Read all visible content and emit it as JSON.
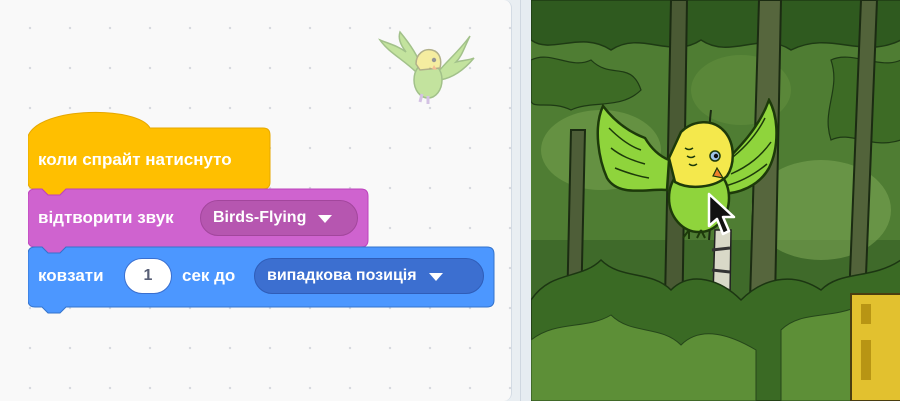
{
  "workspace": {
    "blocks": {
      "event_hat": {
        "label": "коли спрайт натиснуто",
        "color": "#ffbf00"
      },
      "play_sound": {
        "label": "відтворити звук",
        "sound_option": "Birds-Flying",
        "color": "#cf63cf"
      },
      "glide": {
        "label_before": "ковзати",
        "seconds_value": "1",
        "label_after": "сек до",
        "target_option": "випадкова позиція",
        "color": "#4c97ff"
      }
    }
  },
  "stage": {
    "sprite": "parakeet-sprite",
    "backdrop": "forest-backdrop",
    "cursor": "pointer-cursor-icon"
  }
}
